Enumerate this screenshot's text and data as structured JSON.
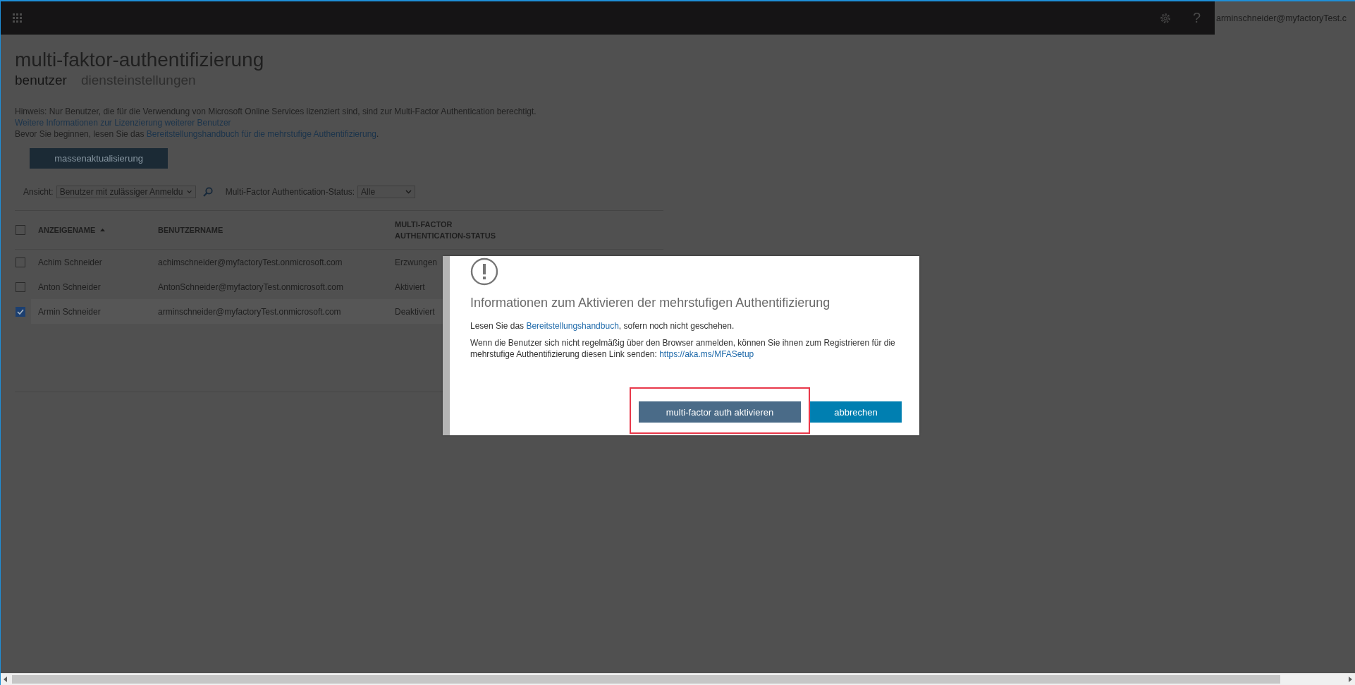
{
  "header": {
    "help": "?",
    "user": "arminschneider@myfactoryTest.c"
  },
  "page": {
    "title": "multi-faktor-authentifizierung",
    "tabs": [
      {
        "label": "benutzer",
        "selected": true
      },
      {
        "label": "diensteinstellungen",
        "selected": false
      }
    ]
  },
  "notice": {
    "text": "Hinweis: Nur Benutzer, die für die Verwendung von Microsoft Online Services lizenziert sind, sind zur Multi-Factor Authentication berechtigt.",
    "link": "Weitere Informationen zur Lizenzierung weiterer Benutzer"
  },
  "intro": {
    "text": "Bevor Sie beginnen, lesen Sie das",
    "link": "Bereitstellungshandbuch für die mehrstufige Authentifizierung",
    "after": "."
  },
  "bulk_button": "massenaktualisierung",
  "filters": {
    "view_label": "Ansicht:",
    "view_value": "Benutzer mit zulässiger Anmeldu",
    "status_label": "Multi-Factor Authentication-Status:",
    "status_value": "Alle"
  },
  "table": {
    "select_all": {
      "checked": false
    },
    "columns": [
      {
        "label": "ANZEIGENAME",
        "sorted": true
      },
      {
        "label": "BENUTZERNAME",
        "sorted": false
      },
      {
        "label": "MULTI-FACTOR AUTHENTICATION-STATUS",
        "sorted": false
      }
    ],
    "rows": [
      {
        "name": "Achim Schneider",
        "username": "achimschneider@myfactoryTest.onmicrosoft.com",
        "status": "Erzwungen",
        "selected": false
      },
      {
        "name": "Anton Schneider",
        "username": "AntonSchneider@myfactoryTest.onmicrosoft.com",
        "status": "Aktiviert",
        "selected": false
      },
      {
        "name": "Armin Schneider",
        "username": "arminschneider@myfactoryTest.onmicrosoft.com",
        "status": "Deaktiviert",
        "selected": true
      }
    ]
  },
  "dialog": {
    "title": "Informationen zum Aktivieren der mehrstufigen Authentifizierung",
    "paragraph_1": {
      "before": "Lesen Sie das",
      "link": "Bereitstellungshandbuch",
      "after": ", sofern noch nicht geschehen."
    },
    "paragraph_2": {
      "before": "Wenn die Benutzer sich nicht regelmäßig über den Browser anmelden, können Sie ihnen zum Registrieren für die mehrstufige Authentifizierung diesen Link senden:",
      "link": "https://aka.ms/MFASetup"
    },
    "buttons": [
      {
        "label": "multi-factor auth aktivieren",
        "kind": "confirm",
        "highlighted": true
      },
      {
        "label": "abbrechen",
        "kind": "cancel",
        "highlighted": false
      }
    ]
  }
}
